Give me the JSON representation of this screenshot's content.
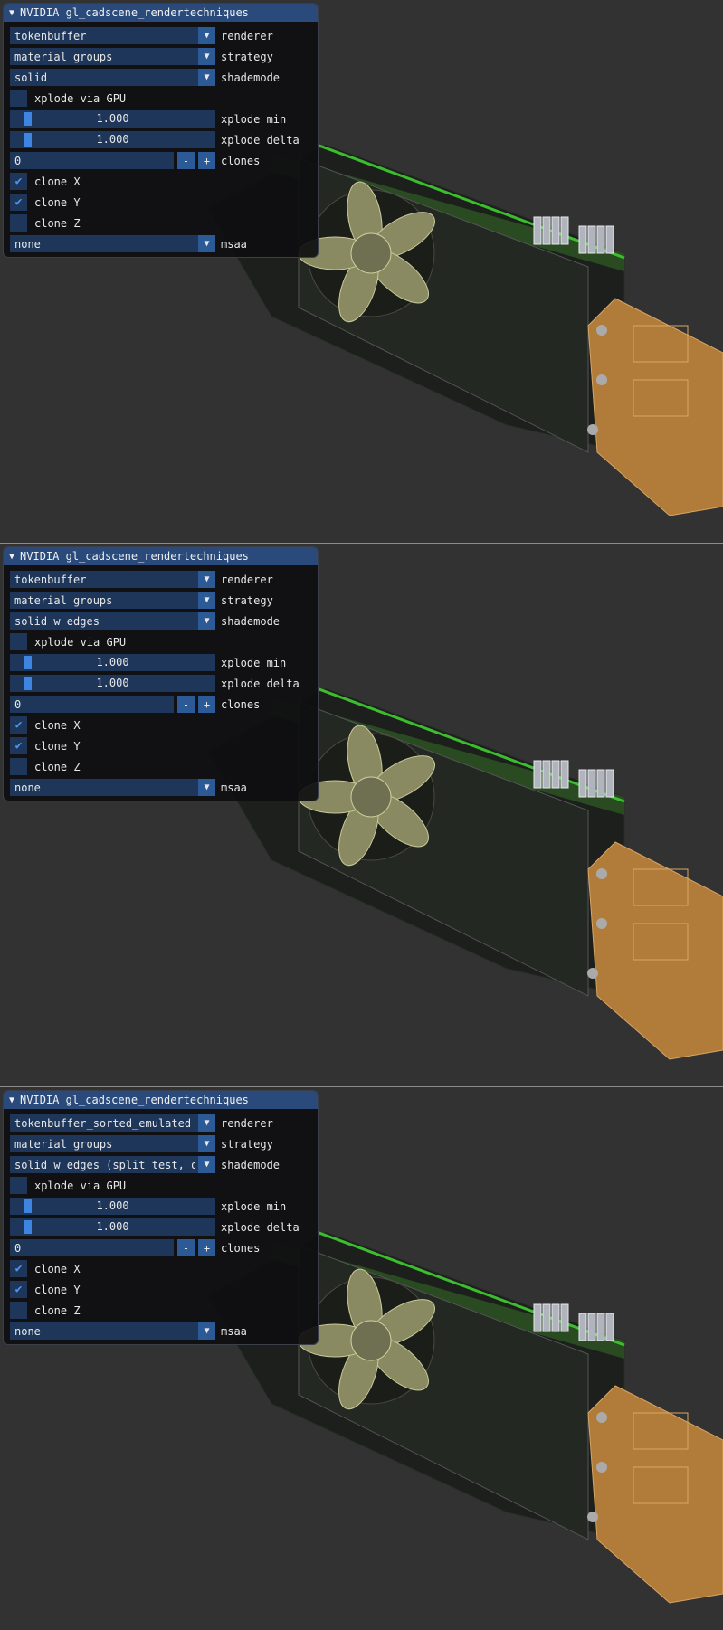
{
  "panels": [
    {
      "title": "NVIDIA gl_cadscene_rendertechniques",
      "renderer": {
        "value": "tokenbuffer",
        "label": "renderer"
      },
      "strategy": {
        "value": "material groups",
        "label": "strategy"
      },
      "shademode": {
        "value": "solid",
        "label": "shademode"
      },
      "xplode_gpu": {
        "label": "xplode via GPU",
        "checked": false
      },
      "xplode_min": {
        "value": "1.000",
        "label": "xplode min"
      },
      "xplode_delta": {
        "value": "1.000",
        "label": "xplode delta"
      },
      "clones": {
        "value": "0",
        "minus": "-",
        "plus": "+",
        "label": "clones"
      },
      "clone_x": {
        "label": "clone X",
        "checked": true
      },
      "clone_y": {
        "label": "clone Y",
        "checked": true
      },
      "clone_z": {
        "label": "clone Z",
        "checked": false
      },
      "msaa": {
        "value": "none",
        "label": "msaa"
      }
    },
    {
      "title": "NVIDIA gl_cadscene_rendertechniques",
      "renderer": {
        "value": "tokenbuffer",
        "label": "renderer"
      },
      "strategy": {
        "value": "material groups",
        "label": "strategy"
      },
      "shademode": {
        "value": "solid w edges",
        "label": "shademode"
      },
      "xplode_gpu": {
        "label": "xplode via GPU",
        "checked": false
      },
      "xplode_min": {
        "value": "1.000",
        "label": "xplode min"
      },
      "xplode_delta": {
        "value": "1.000",
        "label": "xplode delta"
      },
      "clones": {
        "value": "0",
        "minus": "-",
        "plus": "+",
        "label": "clones"
      },
      "clone_x": {
        "label": "clone X",
        "checked": true
      },
      "clone_y": {
        "label": "clone Y",
        "checked": true
      },
      "clone_z": {
        "label": "clone Z",
        "checked": false
      },
      "msaa": {
        "value": "none",
        "label": "msaa"
      }
    },
    {
      "title": "NVIDIA gl_cadscene_rendertechniques",
      "renderer": {
        "value": "tokenbuffer_sorted_emulated",
        "label": "renderer"
      },
      "strategy": {
        "value": "material groups",
        "label": "strategy"
      },
      "shademode": {
        "value": "solid w edges (split test, on",
        "label": "shademode"
      },
      "xplode_gpu": {
        "label": "xplode via GPU",
        "checked": false
      },
      "xplode_min": {
        "value": "1.000",
        "label": "xplode min"
      },
      "xplode_delta": {
        "value": "1.000",
        "label": "xplode delta"
      },
      "clones": {
        "value": "0",
        "minus": "-",
        "plus": "+",
        "label": "clones"
      },
      "clone_x": {
        "label": "clone X",
        "checked": true
      },
      "clone_y": {
        "label": "clone Y",
        "checked": true
      },
      "clone_z": {
        "label": "clone Z",
        "checked": false
      },
      "msaa": {
        "value": "none",
        "label": "msaa"
      }
    }
  ],
  "icons": {
    "collapse": "triangle-down-icon",
    "dropdown": "triangle-down-icon",
    "checkmark": "checkmark-icon"
  },
  "colors": {
    "background": "#323232",
    "title_bar": "#294a7a",
    "widget": "#1d3659",
    "accent": "#3d85e0"
  },
  "xplode_level_fraction": 0.1
}
